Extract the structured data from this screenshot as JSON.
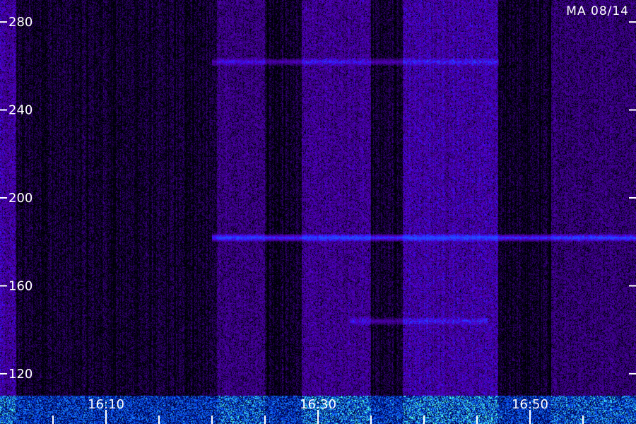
{
  "station_label": "MA 08/14",
  "chart_data": {
    "type": "heatmap",
    "title": "",
    "xlabel": "",
    "ylabel": "",
    "xlim": [
      "16:00",
      "17:00"
    ],
    "ylim": [
      110,
      290
    ],
    "y_ticks": [
      120,
      160,
      200,
      240,
      280
    ],
    "y_tick_labels": [
      "120",
      "160",
      "200",
      "240",
      "280"
    ],
    "x_ticks": [
      "16:10",
      "16:30",
      "16:50"
    ],
    "minor_x_ticks": [
      "16:05",
      "16:15",
      "16:20",
      "16:25",
      "16:35",
      "16:40",
      "16:45",
      "16:55"
    ],
    "colors": {
      "low": "#000000",
      "mid": "#4a00c8",
      "high": "#3355ff",
      "peak": "#66ffee"
    },
    "bright_columns": [
      {
        "x_start": "16:00",
        "x_end": "16:01.5",
        "intensity": 0.9
      },
      {
        "x_start": "16:20.5",
        "x_end": "16:25",
        "intensity": 0.75
      },
      {
        "x_start": "16:28.5",
        "x_end": "16:35",
        "intensity": 0.85
      },
      {
        "x_start": "16:38",
        "x_end": "16:47",
        "intensity": 0.95
      },
      {
        "x_start": "16:52",
        "x_end": "17:00",
        "intensity": 0.7
      }
    ],
    "emission_bands": [
      {
        "y": 182,
        "x_start": "16:20",
        "x_end": "17:00",
        "intensity": 1.0
      },
      {
        "y": 262,
        "x_start": "16:20",
        "x_end": "16:47",
        "intensity": 0.5
      },
      {
        "y": 144,
        "x_start": "16:33",
        "x_end": "16:46",
        "intensity": 0.45
      }
    ]
  }
}
